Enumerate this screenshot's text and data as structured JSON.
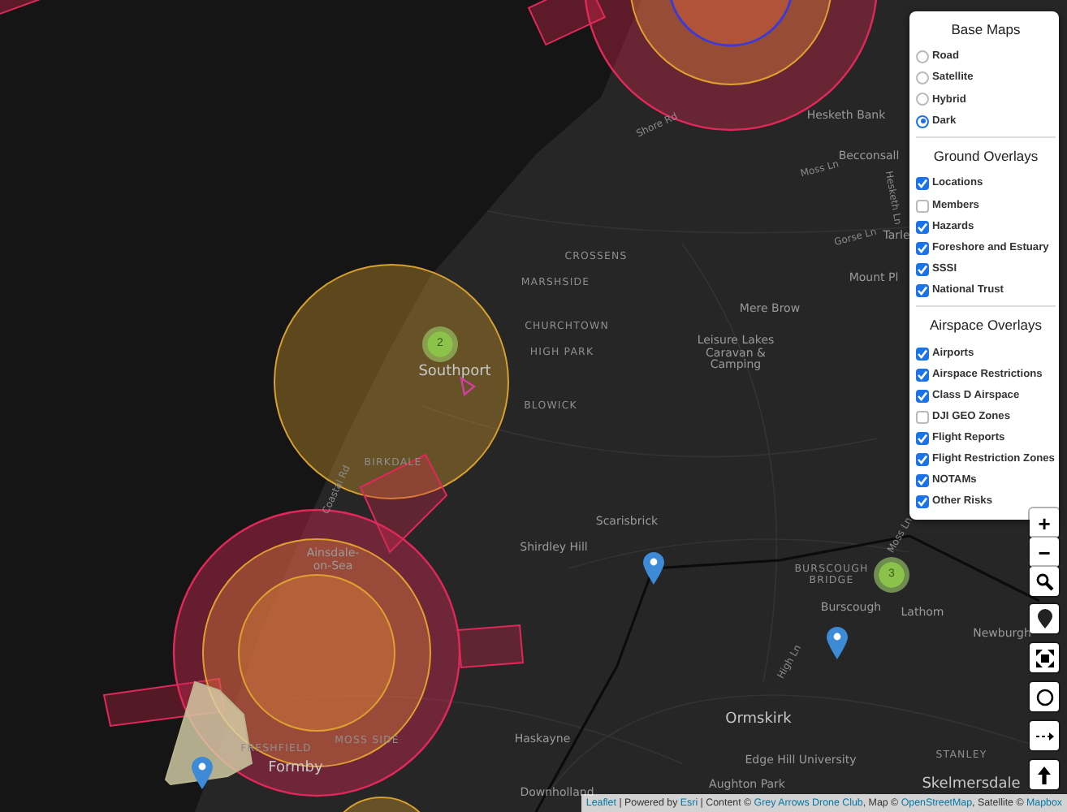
{
  "map": {
    "place_labels": [
      {
        "text": "Hesketh Bank",
        "kind": "village"
      },
      {
        "text": "Becconsall",
        "kind": "village"
      },
      {
        "text": "Shore Rd",
        "kind": "road"
      },
      {
        "text": "Moss Ln",
        "kind": "road"
      },
      {
        "text": "Hesketh Ln",
        "kind": "road"
      },
      {
        "text": "Gorse Ln",
        "kind": "road"
      },
      {
        "text": "Tarle",
        "kind": "village"
      },
      {
        "text": "Mount Pl",
        "kind": "village"
      },
      {
        "text": "CROSSENS",
        "kind": "district"
      },
      {
        "text": "MARSHSIDE",
        "kind": "district"
      },
      {
        "text": "CHURCHTOWN",
        "kind": "district"
      },
      {
        "text": "HIGH PARK",
        "kind": "district"
      },
      {
        "text": "Southport",
        "kind": "town"
      },
      {
        "text": "BLOWICK",
        "kind": "district"
      },
      {
        "text": "BIRKDALE",
        "kind": "district"
      },
      {
        "text": "Coastal Rd",
        "kind": "road"
      },
      {
        "text": "Mere Brow",
        "kind": "village"
      },
      {
        "text": "Leisure Lakes Caravan & Camping",
        "kind": "village"
      },
      {
        "text": "Scarisbrick",
        "kind": "village"
      },
      {
        "text": "Shirdley Hill",
        "kind": "village"
      },
      {
        "text": "Ainsdale-on-Sea",
        "kind": "village"
      },
      {
        "text": "BURSCOUGH BRIDGE",
        "kind": "district"
      },
      {
        "text": "Burscough",
        "kind": "village"
      },
      {
        "text": "Lathom",
        "kind": "village"
      },
      {
        "text": "Newburgh",
        "kind": "village"
      },
      {
        "text": "Moss Ln",
        "kind": "road"
      },
      {
        "text": "High Ln",
        "kind": "road"
      },
      {
        "text": "Ormskirk",
        "kind": "town"
      },
      {
        "text": "Edge Hill University",
        "kind": "village"
      },
      {
        "text": "Aughton Park",
        "kind": "village"
      },
      {
        "text": "STANLEY",
        "kind": "district"
      },
      {
        "text": "Skelmersdale",
        "kind": "town"
      },
      {
        "text": "Haskayne",
        "kind": "village"
      },
      {
        "text": "Downholland",
        "kind": "village"
      },
      {
        "text": "FRESHFIELD",
        "kind": "district"
      },
      {
        "text": "MOSS SIDE",
        "kind": "district"
      },
      {
        "text": "Formby",
        "kind": "town"
      }
    ],
    "clusters": [
      {
        "count": "2"
      },
      {
        "count": "3"
      }
    ]
  },
  "layers_panel": {
    "sections": [
      {
        "title": "Base Maps",
        "kind": "radio",
        "items": [
          {
            "label": "Road",
            "selected": false
          },
          {
            "label": "Satellite",
            "selected": false
          },
          {
            "label": "Hybrid",
            "selected": false
          },
          {
            "label": "Dark",
            "selected": true
          }
        ]
      },
      {
        "title": "Ground Overlays",
        "kind": "checkbox",
        "items": [
          {
            "label": "Locations",
            "checked": true
          },
          {
            "label": "Members",
            "checked": false
          },
          {
            "label": "Hazards",
            "checked": true
          },
          {
            "label": "Foreshore and Estuary",
            "checked": true
          },
          {
            "label": "SSSI",
            "checked": true
          },
          {
            "label": "National Trust",
            "checked": true
          }
        ]
      },
      {
        "title": "Airspace Overlays",
        "kind": "checkbox",
        "items": [
          {
            "label": "Airports",
            "checked": true
          },
          {
            "label": "Airspace Restrictions",
            "checked": true
          },
          {
            "label": "Class D Airspace",
            "checked": true
          },
          {
            "label": "DJI GEO Zones",
            "checked": false
          },
          {
            "label": "Flight Reports",
            "checked": true
          },
          {
            "label": "Flight Restriction Zones",
            "checked": true
          },
          {
            "label": "NOTAMs",
            "checked": true
          },
          {
            "label": "Other Risks",
            "checked": true
          }
        ]
      }
    ]
  },
  "zoom_controls": [
    {
      "label": "+"
    },
    {
      "label": "−"
    }
  ],
  "attribution": [
    {
      "text": "Leaflet",
      "kind": "link"
    },
    {
      "text": " | Powered by ",
      "kind": "text"
    },
    {
      "text": "Esri",
      "kind": "link"
    },
    {
      "text": " | Content © ",
      "kind": "text"
    },
    {
      "text": "Grey Arrows Drone Club",
      "kind": "link"
    },
    {
      "text": ", Map © ",
      "kind": "text"
    },
    {
      "text": "OpenStreetMap",
      "kind": "link"
    },
    {
      "text": ", Satellite © ",
      "kind": "text"
    },
    {
      "text": "Mapbox",
      "kind": "link"
    }
  ]
}
